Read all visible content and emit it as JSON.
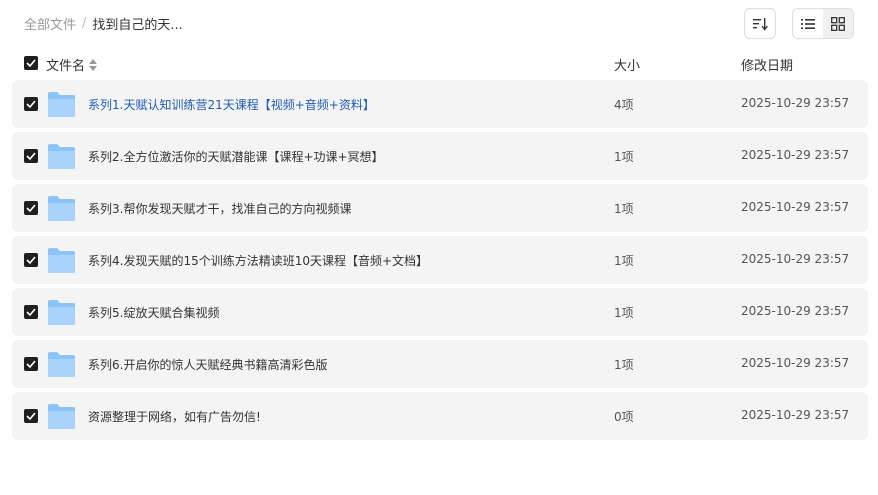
{
  "breadcrumb": {
    "root": "全部文件",
    "separator": "/",
    "current": "找到自己的天..."
  },
  "toolbar": {
    "sort_icon": "sort-icon",
    "list_icon": "list-view-icon",
    "grid_icon": "grid-view-icon"
  },
  "table": {
    "columns": {
      "name": "文件名",
      "size": "大小",
      "date": "修改日期"
    },
    "rows": [
      {
        "name": "系列1.天赋认知训练营21天课程【视频+音频+资料】",
        "size": "4项",
        "date": "2025-10-29 23:57",
        "active": true
      },
      {
        "name": "系列2.全方位激活你的天赋潜能课【课程+功课+冥想】",
        "size": "1项",
        "date": "2025-10-29 23:57"
      },
      {
        "name": "系列3.帮你发现天赋才干，找准自己的方向视频课",
        "size": "1项",
        "date": "2025-10-29 23:57"
      },
      {
        "name": "系列4.发现天赋的15个训练方法精读班10天课程【音频+文档】",
        "size": "1项",
        "date": "2025-10-29 23:57"
      },
      {
        "name": "系列5.绽放天赋合集视频",
        "size": "1项",
        "date": "2025-10-29 23:57"
      },
      {
        "name": "系列6.开启你的惊人天赋经典书籍高清彩色版",
        "size": "1项",
        "date": "2025-10-29 23:57"
      },
      {
        "name": "资源整理于网络，如有广告勿信!",
        "size": "0项",
        "date": "2025-10-29 23:57"
      }
    ]
  },
  "colors": {
    "link": "#1e5bb8",
    "row_bg": "#f4f4f4",
    "checkbox": "#1f1f1f",
    "folder": "#7ab8f5"
  }
}
